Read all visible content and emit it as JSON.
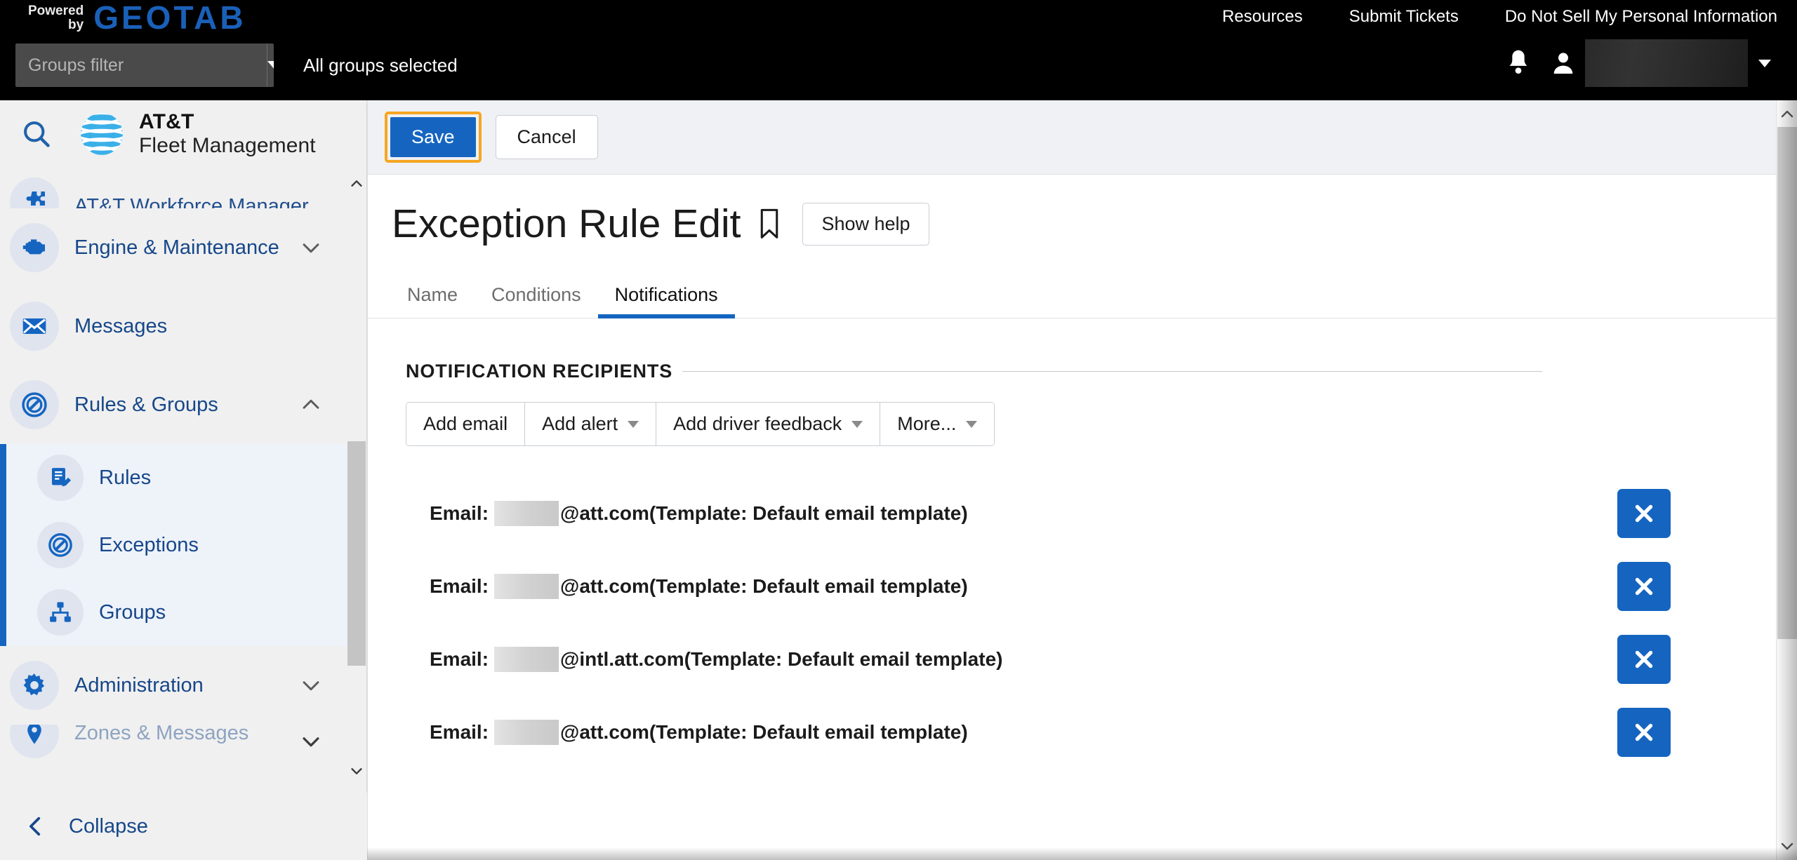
{
  "topbar": {
    "powered_by_line1": "Powered",
    "powered_by_line2": "by",
    "brand_logo_text": "GEOTAB",
    "links": [
      {
        "label": "Resources"
      },
      {
        "label": "Submit Tickets"
      },
      {
        "label": "Do Not Sell My Personal Information"
      }
    ],
    "groups_filter_placeholder": "Groups filter",
    "groups_filter_value": "",
    "groups_selected_text": "All groups selected",
    "notifications_icon": "bell-icon",
    "user_icon": "user-avatar-icon",
    "user_name": "",
    "user_menu_icon": "chevron-down-icon"
  },
  "sidebar": {
    "search_icon": "search-icon",
    "brand_line1": "AT&T",
    "brand_line2": "Fleet Management",
    "items": [
      {
        "label": "AT&T Workforce Manager",
        "icon": "puzzle-icon",
        "state": "partial"
      },
      {
        "label": "Engine & Maintenance",
        "icon": "engine-icon",
        "chevron": "chevron-down-icon"
      },
      {
        "label": "Messages",
        "icon": "envelope-icon",
        "chevron": ""
      },
      {
        "label": "Rules & Groups",
        "icon": "rule-circle-icon",
        "chevron": "chevron-up-icon"
      }
    ],
    "subitems": [
      {
        "label": "Rules",
        "icon": "document-edit-icon"
      },
      {
        "label": "Exceptions",
        "icon": "no-entry-icon"
      },
      {
        "label": "Groups",
        "icon": "org-tree-icon"
      }
    ],
    "items_after": [
      {
        "label": "Administration",
        "icon": "gear-icon",
        "chevron": "chevron-down-icon"
      },
      {
        "label": "Zones & Messages",
        "icon": "map-pin-icon",
        "chevron": "chevron-down-icon",
        "state": "partial"
      }
    ],
    "collapse_label": "Collapse",
    "collapse_icon": "chevron-left-icon",
    "scroll_up_icon": "chevron-up-icon",
    "scroll_down_icon": "chevron-down-icon"
  },
  "main": {
    "action_bar": {
      "save_label": "Save",
      "cancel_label": "Cancel"
    },
    "page_title": "Exception Rule Edit",
    "bookmark_icon": "bookmark-icon",
    "show_help_label": "Show help",
    "tabs": [
      {
        "label": "Name",
        "active": false
      },
      {
        "label": "Conditions",
        "active": false
      },
      {
        "label": "Notifications",
        "active": true
      }
    ],
    "section_title": "NOTIFICATION RECIPIENTS",
    "toolbar_buttons": [
      {
        "label": "Add email",
        "has_caret": false
      },
      {
        "label": "Add alert",
        "has_caret": true
      },
      {
        "label": "Add driver feedback",
        "has_caret": true
      },
      {
        "label": "More...",
        "has_caret": true
      }
    ],
    "recipients": [
      {
        "prefix": "Email:",
        "redacted": true,
        "domain": "@att.com",
        "suffix": " (Template: Default email template)",
        "delete_icon": "close-x-icon"
      },
      {
        "prefix": "Email:",
        "redacted": true,
        "domain": "@att.com",
        "suffix": " (Template: Default email template)",
        "delete_icon": "close-x-icon"
      },
      {
        "prefix": "Email:",
        "redacted": true,
        "domain": "@intl.att.com",
        "suffix": " (Template: Default email template)",
        "delete_icon": "close-x-icon"
      },
      {
        "prefix": "Email:",
        "redacted": true,
        "domain": "@att.com",
        "suffix": " (Template: Default email template)",
        "delete_icon": "close-x-icon"
      }
    ],
    "scroll_up_icon": "chevron-up-icon",
    "scroll_down_icon": "chevron-down-icon"
  },
  "colors": {
    "brand_blue": "#1565c0",
    "geotab_blue": "#1a60b8",
    "focus_orange": "#f5a623",
    "nav_text_blue": "#16478a",
    "topbar_black": "#000000"
  }
}
